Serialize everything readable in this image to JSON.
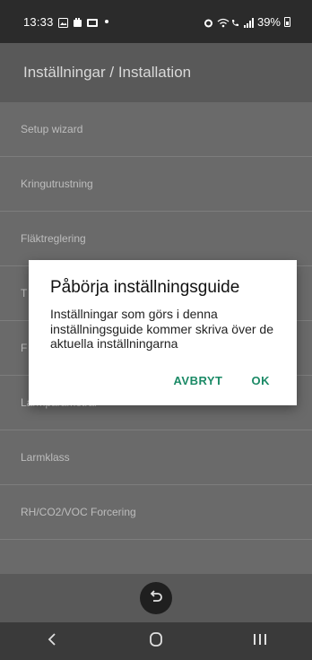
{
  "status_bar": {
    "time": "13:33",
    "battery": "39%"
  },
  "app_bar": {
    "title": "Inställningar / Installation"
  },
  "list": {
    "items": [
      "Setup wizard",
      "Kringutrustning",
      "Fläktreglering",
      "T",
      "F",
      "Larmparametrar",
      "Larmklass",
      "RH/CO2/VOC Forcering"
    ]
  },
  "dialog": {
    "title": "Påbörja inställningsguide",
    "body": "Inställningar som görs i denna inställningsguide kommer skriva över de aktuella inställningarna",
    "cancel_label": "AVBRYT",
    "ok_label": "OK"
  },
  "colors": {
    "accent": "#1b8a66",
    "app_bar": "#595959",
    "overlay_list": "#6a6a6a",
    "status_bar": "#2b2b2b"
  }
}
